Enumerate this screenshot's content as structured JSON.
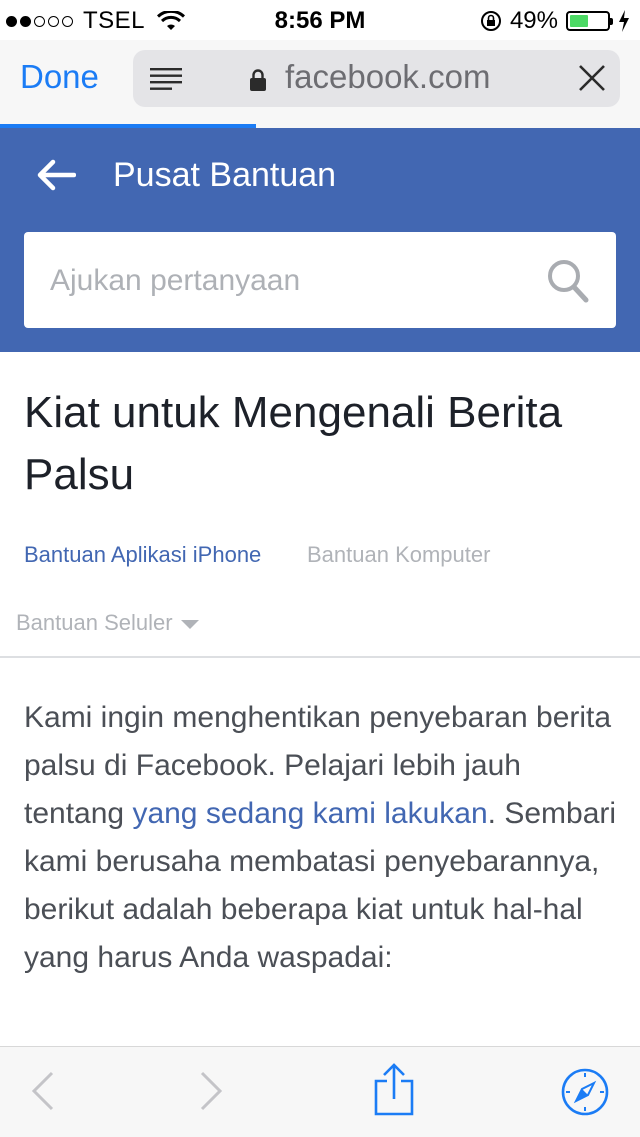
{
  "status_bar": {
    "carrier": "TSEL",
    "time": "8:56 PM",
    "battery_percent": "49%",
    "battery_level": 0.49,
    "signal_bars_filled": 2,
    "signal_bars_total": 5
  },
  "browser": {
    "done_label": "Done",
    "url": "facebook.com",
    "accent_color": "#1b7cf5",
    "load_progress": 0.4
  },
  "header": {
    "title": "Pusat Bantuan",
    "search_placeholder": "Ajukan pertanyaan",
    "brand_color": "#4267b2"
  },
  "article": {
    "title": "Kiat untuk Mengenali Berita Palsu",
    "tabs": [
      {
        "label": "Bantuan Aplikasi iPhone",
        "active": true
      },
      {
        "label": "Bantuan Komputer",
        "active": false
      },
      {
        "label": "Bantuan Seluler",
        "active": false
      }
    ],
    "body_before_link": "Kami ingin menghentikan penyebaran berita palsu di Facebook. Pelajari lebih jauh tentang ",
    "body_link": "yang sedang kami lakukan",
    "body_after_link": ". Sembari kami berusaha membatasi penyebarannya, berikut adalah beberapa kiat untuk hal-hal yang harus Anda waspadai:"
  },
  "toolbar": {
    "icons": [
      "back-icon",
      "forward-icon",
      "share-icon",
      "bookmarks-icon"
    ]
  }
}
